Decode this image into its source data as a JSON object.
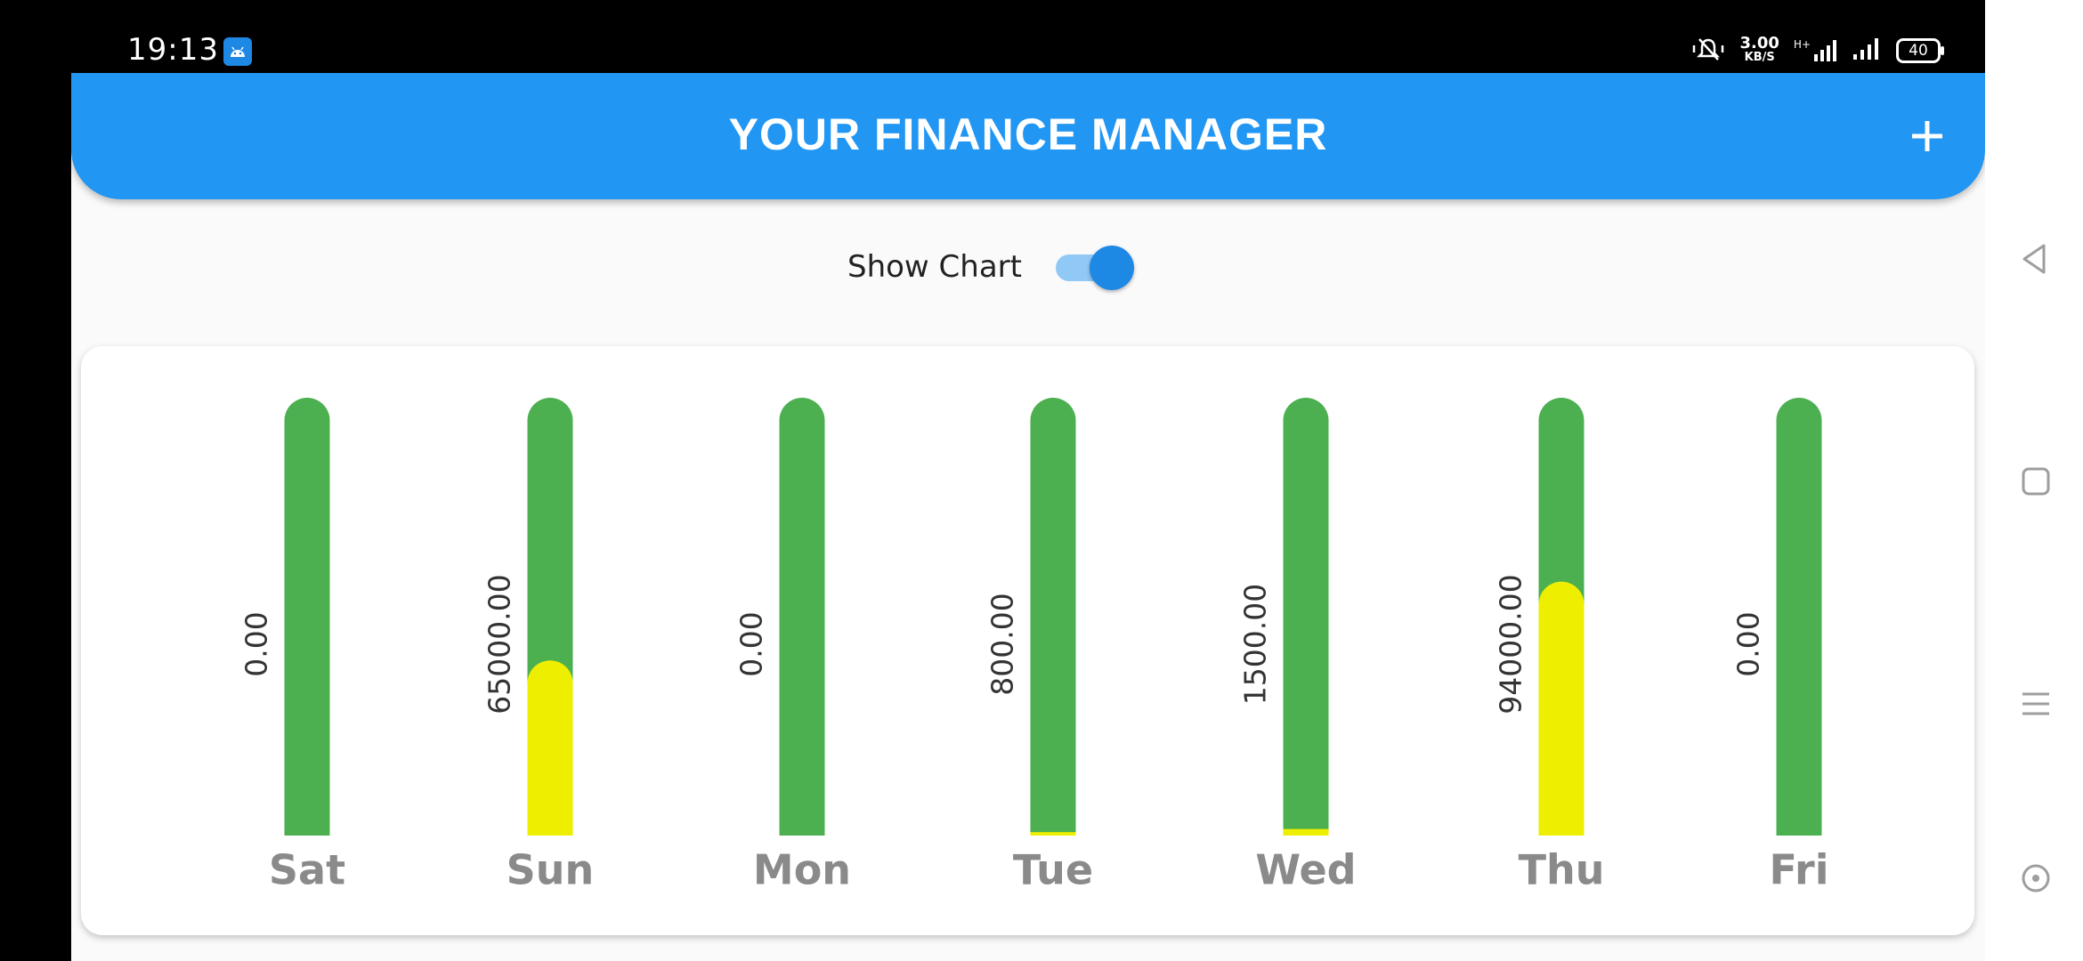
{
  "status_bar": {
    "time": "19:13",
    "net_speed_value": "3.00",
    "net_speed_unit": "KB/S",
    "network_type": "H+",
    "battery": "40"
  },
  "app_bar": {
    "title": "YOUR FINANCE MANAGER",
    "add_icon": "plus-icon"
  },
  "toggle": {
    "label": "Show Chart",
    "on": true
  },
  "colors": {
    "primary": "#2196f3",
    "bar_background": "#4caf50",
    "bar_fill": "#eeee00",
    "day_label": "#8a8a8a"
  },
  "chart_data": {
    "type": "bar",
    "categories": [
      "Sat",
      "Sun",
      "Mon",
      "Tue",
      "Wed",
      "Thu",
      "Fri"
    ],
    "values": [
      0,
      65000,
      0,
      800,
      1500,
      94000,
      0
    ],
    "value_labels": [
      "0.00",
      "65000.00",
      "0.00",
      "800.00",
      "1500.00",
      "94000.00",
      "0.00"
    ],
    "fill_fractions": [
      0,
      0.4,
      0,
      0.008,
      0.015,
      0.58,
      0
    ],
    "title": "",
    "xlabel": "",
    "ylabel": ""
  },
  "nav_bar": {
    "buttons": [
      "back-triangle-icon",
      "home-square-icon",
      "menu-lines-icon",
      "assistant-circle-icon"
    ]
  }
}
